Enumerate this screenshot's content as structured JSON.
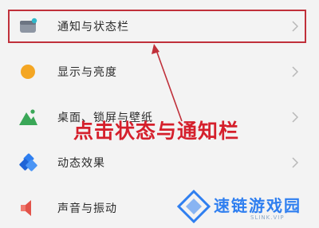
{
  "settings_list": [
    {
      "label": "通知与状态栏",
      "icon": "notification-icon"
    },
    {
      "label": "显示与亮度",
      "icon": "display-brightness-icon"
    },
    {
      "label": "桌面、锁屏与壁纸",
      "icon": "wallpaper-icon"
    },
    {
      "label": "动态效果",
      "icon": "motion-effects-icon"
    },
    {
      "label": "声音与振动",
      "icon": "sound-vibration-icon"
    }
  ],
  "annotation": {
    "text": "点击状态与通知栏",
    "color": "#d5202c"
  },
  "watermark": {
    "brand": "速链游戏园",
    "sub": "SLINK.VIP",
    "color": "#2f7ff0"
  },
  "colors": {
    "highlight": "#c0303a",
    "orange": "#f4a623",
    "green": "#3aa757",
    "blue": "#2f7ff0",
    "red": "#e2534a"
  }
}
